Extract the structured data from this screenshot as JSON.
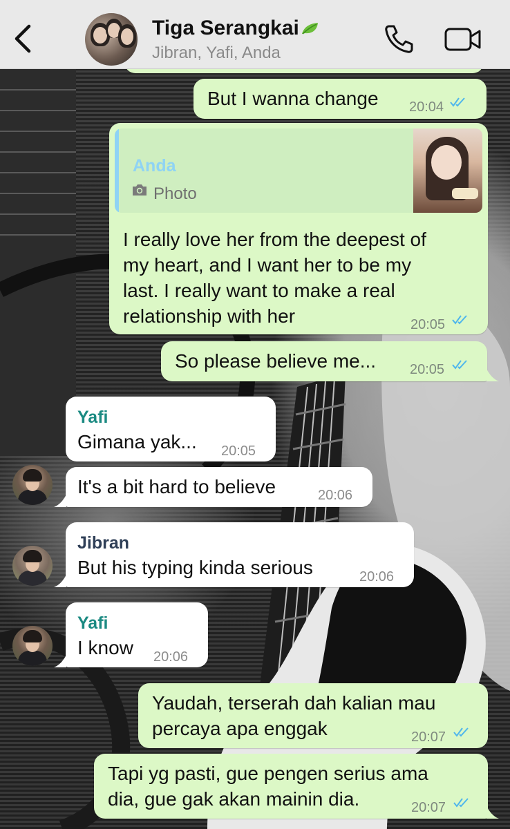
{
  "header": {
    "back_icon": "chevron-left-icon",
    "title": "Tiga Serangkai",
    "title_emoji": "leaf-icon",
    "subtitle": "Jibran, Yafi, Anda",
    "call_icon": "phone-icon",
    "video_icon": "video-camera-icon"
  },
  "colors": {
    "outgoing_bubble": "#dcf8c6",
    "incoming_bubble": "#ffffff",
    "read_ticks": "#4fb6ec",
    "sender_yafi": "#1b8a82",
    "sender_jibran": "#2f3f57",
    "quote_author": "#8fd3f4"
  },
  "messages": [
    {
      "direction": "out",
      "text": "But I wanna change",
      "time": "20:04",
      "status": "read"
    },
    {
      "direction": "out",
      "quote": {
        "author": "Anda",
        "type_label": "Photo",
        "type_icon": "camera-icon"
      },
      "lines": [
        "I really love her from the deepest of",
        "my heart, and I want her to be my",
        "last. I really want to make a real",
        "relationship with her"
      ],
      "time": "20:05",
      "status": "read"
    },
    {
      "direction": "out",
      "text": "So please believe me...",
      "time": "20:05",
      "status": "read"
    },
    {
      "direction": "in",
      "sender": "Yafi",
      "text": "Gimana yak...",
      "time": "20:05"
    },
    {
      "direction": "in",
      "text": "It's a bit hard to believe",
      "time": "20:06"
    },
    {
      "direction": "in",
      "sender": "Jibran",
      "text": "But his typing kinda serious",
      "time": "20:06"
    },
    {
      "direction": "in",
      "sender": "Yafi",
      "text": "I know",
      "time": "20:06"
    },
    {
      "direction": "out",
      "lines": [
        "Yaudah, terserah dah kalian mau",
        "percaya apa enggak"
      ],
      "time": "20:07",
      "status": "read"
    },
    {
      "direction": "out",
      "lines": [
        "Tapi yg pasti, gue pengen serius ama",
        "dia, gue gak akan mainin dia."
      ],
      "time": "20:07",
      "status": "read"
    }
  ]
}
